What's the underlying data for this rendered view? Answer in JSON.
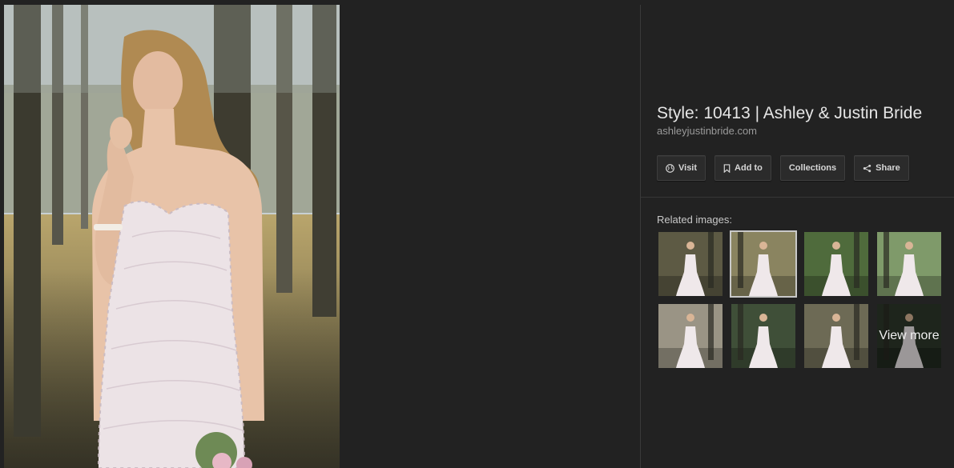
{
  "image": {
    "subject": "bride in strapless lace gown holding bouquet in a forest"
  },
  "details": {
    "title": "Style: 10413 | Ashley & Justin Bride",
    "domain": "ashleyjustinbride.com"
  },
  "actions": [
    {
      "label": "Visit",
      "icon": "globe-icon"
    },
    {
      "label": "Add to",
      "icon": "bookmark-icon"
    },
    {
      "label": "Collections",
      "icon": ""
    },
    {
      "label": "Share",
      "icon": "share-icon"
    }
  ],
  "related": {
    "label": "Related images:",
    "view_more": "View more",
    "thumbnails": [
      {
        "background": "#5d5a44",
        "selected": false
      },
      {
        "background": "#8a8460",
        "selected": true
      },
      {
        "background": "#4f6b3c",
        "selected": false
      },
      {
        "background": "#7f9a6a",
        "selected": false
      },
      {
        "background": "#9a9485",
        "selected": false
      },
      {
        "background": "#3f4f38",
        "selected": false
      },
      {
        "background": "#6d6a55",
        "selected": false
      },
      {
        "background": "#2f3a2c",
        "selected": false
      }
    ]
  },
  "colors": {
    "background": "#222222",
    "panel_text": "#e6e6e6",
    "muted_text": "#9a9a9a",
    "button_bg": "#2b2b2b",
    "selected_outline": "#c9c9c9"
  }
}
